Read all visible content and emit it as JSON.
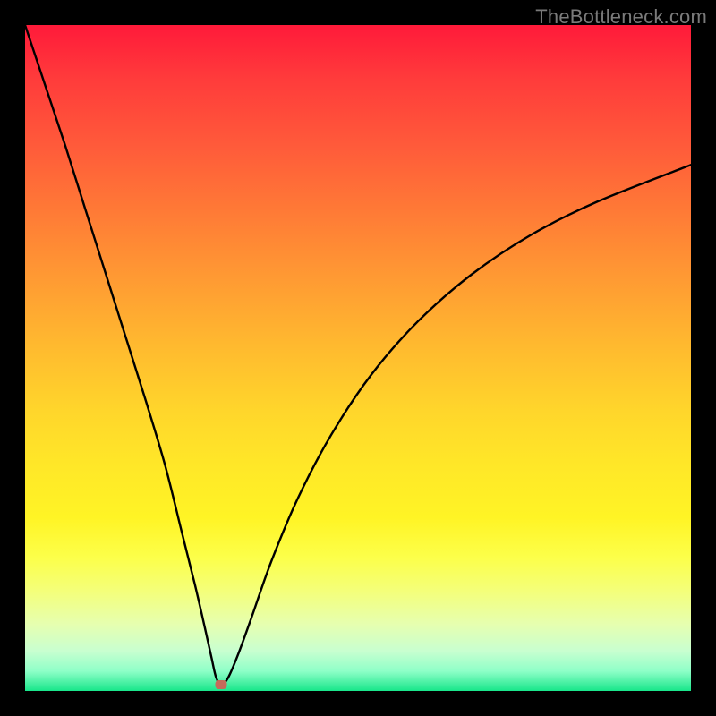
{
  "attribution": "TheBottleneck.com",
  "chart_data": {
    "type": "line",
    "title": "",
    "xlabel": "",
    "ylabel": "",
    "xlim": [
      0,
      100
    ],
    "ylim": [
      0,
      100
    ],
    "series": [
      {
        "name": "bottleneck-curve",
        "x": [
          0,
          3,
          6,
          9,
          12,
          15,
          18,
          21,
          23.5,
          25.5,
          27,
          28,
          28.7,
          29.5,
          30.5,
          32,
          34,
          37,
          41,
          46,
          52,
          59,
          67,
          76,
          86,
          100
        ],
        "values": [
          100,
          91,
          82,
          72.5,
          63,
          53.5,
          44,
          34,
          24,
          16,
          9.5,
          5,
          2,
          1,
          2,
          5.5,
          11,
          19.5,
          29,
          38.5,
          47.5,
          55.5,
          62.5,
          68.5,
          73.5,
          79
        ]
      }
    ],
    "marker": {
      "x": 29.5,
      "y": 1,
      "color": "#c56a5a"
    },
    "gradient_colors": [
      "#ff1a3a",
      "#ff9a33",
      "#ffe728",
      "#fcff4a",
      "#18e68a"
    ]
  }
}
